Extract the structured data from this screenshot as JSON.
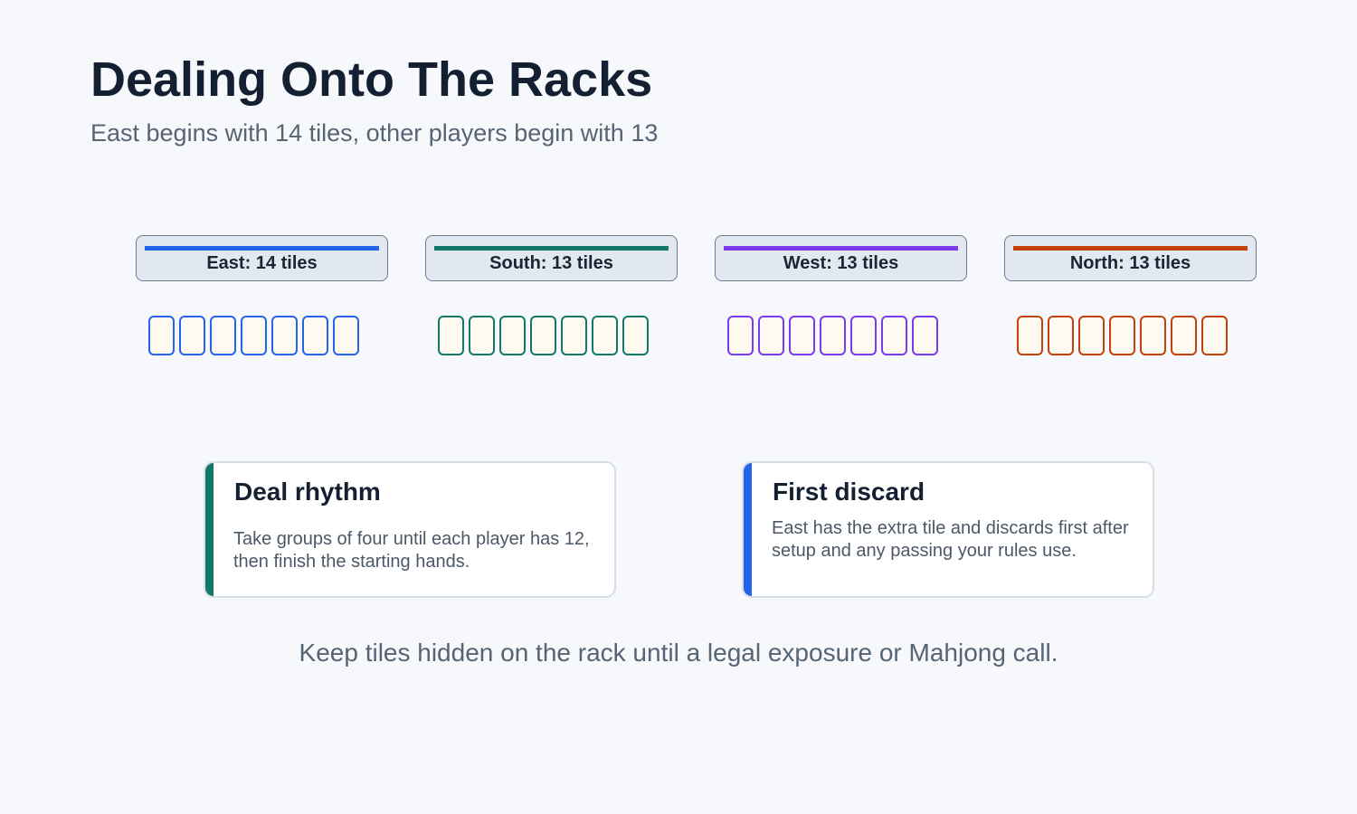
{
  "header": {
    "title": "Dealing Onto The Racks",
    "subtitle": "East begins with 14 tiles, other players begin with 13"
  },
  "racks": [
    {
      "label": "East: 14 tiles",
      "color": "#2563eb",
      "tiles_shown": 7
    },
    {
      "label": "South: 13 tiles",
      "color": "#11786a",
      "tiles_shown": 7
    },
    {
      "label": "West: 13 tiles",
      "color": "#7c3aed",
      "tiles_shown": 7
    },
    {
      "label": "North: 13 tiles",
      "color": "#c2410c",
      "tiles_shown": 7
    }
  ],
  "cards": [
    {
      "title": "Deal rhythm",
      "text": "Take groups of four until each player has 12, then finish the starting hands.",
      "accent": "#11786a"
    },
    {
      "title": "First discard",
      "text": "East has the extra tile and discards first after setup and any passing your rules use.",
      "accent": "#2563eb"
    }
  ],
  "footer": {
    "note": "Keep tiles hidden on the rack until a legal exposure or Mahjong call."
  },
  "colors": {
    "tile_fill": "#fffaf0",
    "background": "#f6f8fb"
  }
}
